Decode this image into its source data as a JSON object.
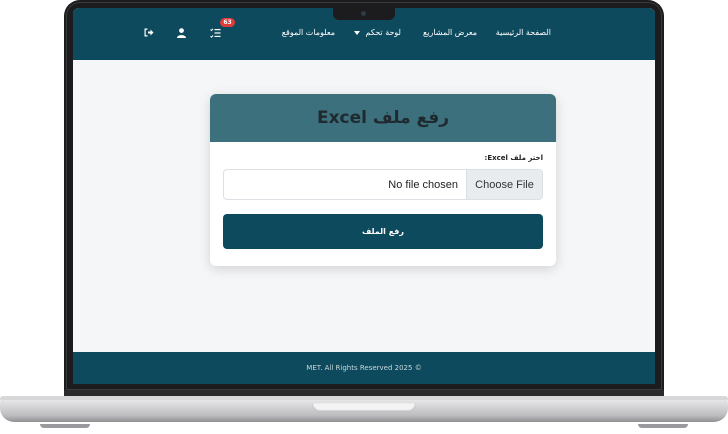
{
  "nav": {
    "home": "الصفحة الرئيسية",
    "projects": "معرض المشاريع",
    "dashboard": "لوحة تحكم",
    "site_info": "معلومات الموقع",
    "notification_count": "63",
    "icons": [
      "tasks-icon",
      "user-icon",
      "logout-icon"
    ]
  },
  "card": {
    "title": "رفع ملف Excel",
    "field_label": "اختر ملف Excel:",
    "file_status": "No file chosen",
    "choose_button": "Choose File",
    "submit_button": "رفع الملف"
  },
  "footer": {
    "text": "MET. All Rights Reserved 2025 ©"
  },
  "colors": {
    "primary": "#0e4a5e",
    "card_header": "#3c707c",
    "badge": "#e03b3b"
  }
}
